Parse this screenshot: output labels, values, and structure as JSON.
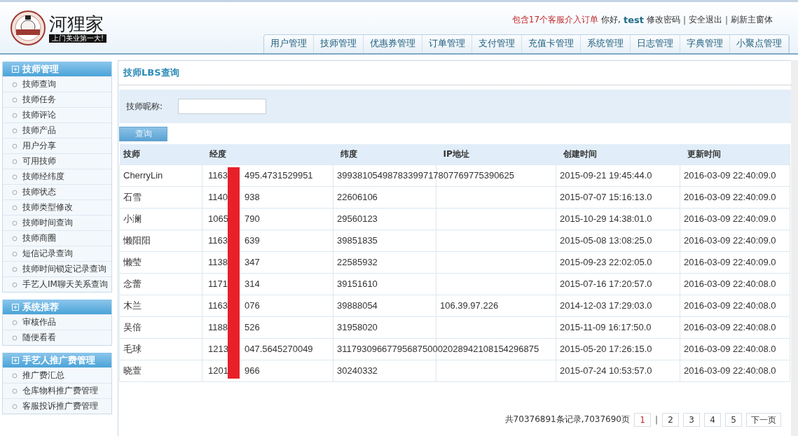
{
  "header": {
    "logo": {
      "name": "河狸家",
      "slogan": "上门美业第一大!"
    },
    "notice": "包含17个客服介入订单",
    "greeting": "你好,",
    "user": "test",
    "links": [
      "修改密码",
      "安全退出",
      "刷新主窗体"
    ],
    "link_separator": "|",
    "nav": [
      "用户管理",
      "技师管理",
      "优惠券管理",
      "订单管理",
      "支付管理",
      "充值卡管理",
      "系统管理",
      "日志管理",
      "字典管理",
      "小聚点管理"
    ]
  },
  "sidebar": {
    "groups": [
      {
        "title": "技师管理",
        "items": [
          "技师查询",
          "技师任务",
          "技师评论",
          "技师产品",
          "用户分享",
          "可用技师",
          "技师经纬度",
          "技师状态",
          "技师类型修改",
          "技师时间查询",
          "技师商圈",
          "短信记录查询",
          "技师时间锁定记录查询",
          "手艺人IM聊天关系查询"
        ]
      },
      {
        "title": "系统推荐",
        "items": [
          "审核作品",
          "随便看看"
        ]
      },
      {
        "title": "手艺人推广费管理",
        "items": [
          "推广费汇总",
          "仓库物料推广费管理",
          "客服投诉推广费管理"
        ]
      }
    ]
  },
  "main": {
    "title": "技师LBS查询",
    "search": {
      "label": "技师昵称:"
    },
    "query_button": "查询",
    "table": {
      "columns": [
        "技师",
        "经度",
        "纬度",
        "IP地址",
        "创建时间",
        "更新时间"
      ],
      "rows": [
        {
          "cells": [
            "CherryLin",
            "1163",
            "39938105498783399717807769775390625",
            "",
            "2015-09-21 19:45:44.0",
            "2016-03-09 22:40:09.0"
          ],
          "longitude_tail": "495.4731529951"
        },
        {
          "cells": [
            "石雪",
            "1140",
            "22606106",
            "",
            "2015-07-07 15:16:13.0",
            "2016-03-09 22:40:09.0"
          ],
          "longitude_tail": "938"
        },
        {
          "cells": [
            "小澜",
            "1065",
            "29560123",
            "",
            "2015-10-29 14:38:01.0",
            "2016-03-09 22:40:09.0"
          ],
          "longitude_tail": "790"
        },
        {
          "cells": [
            "懒阳阳",
            "1163",
            "39851835",
            "",
            "2015-05-08 13:08:25.0",
            "2016-03-09 22:40:09.0"
          ],
          "longitude_tail": "639"
        },
        {
          "cells": [
            "懒莹",
            "1138",
            "22585932",
            "",
            "2015-09-23 22:02:05.0",
            "2016-03-09 22:40:09.0"
          ],
          "longitude_tail": "347"
        },
        {
          "cells": [
            "念蕾",
            "1171",
            "39151610",
            "",
            "2015-07-16 17:20:57.0",
            "2016-03-09 22:40:08.0"
          ],
          "longitude_tail": "314"
        },
        {
          "cells": [
            "木兰",
            "1163",
            "39888054",
            "106.39.97.226",
            "2014-12-03 17:29:03.0",
            "2016-03-09 22:40:08.0"
          ],
          "longitude_tail": "076"
        },
        {
          "cells": [
            "吴倍",
            "1188",
            "31958020",
            "",
            "2015-11-09 16:17:50.0",
            "2016-03-09 22:40:08.0"
          ],
          "longitude_tail": "526"
        },
        {
          "cells": [
            "毛球",
            "1213",
            "3117930966779568750002028942108154296875",
            "",
            "2015-05-20 17:26:15.0",
            "2016-03-09 22:40:08.0"
          ],
          "longitude_tail": "047.5645270049"
        },
        {
          "cells": [
            "晓萱",
            "1201",
            "30240332",
            "",
            "2015-07-24 10:53:57.0",
            "2016-03-09 22:40:08.0"
          ],
          "longitude_tail": "966"
        }
      ]
    },
    "pagination": {
      "summary": "共70376891条记录,7037690页",
      "separator": "|",
      "pages": [
        {
          "label": "1",
          "selected": true
        },
        {
          "label": "2",
          "selected": false
        },
        {
          "label": "3",
          "selected": false
        },
        {
          "label": "4",
          "selected": false
        },
        {
          "label": "5",
          "selected": false
        },
        {
          "label": "下一页",
          "selected": false
        }
      ]
    }
  }
}
